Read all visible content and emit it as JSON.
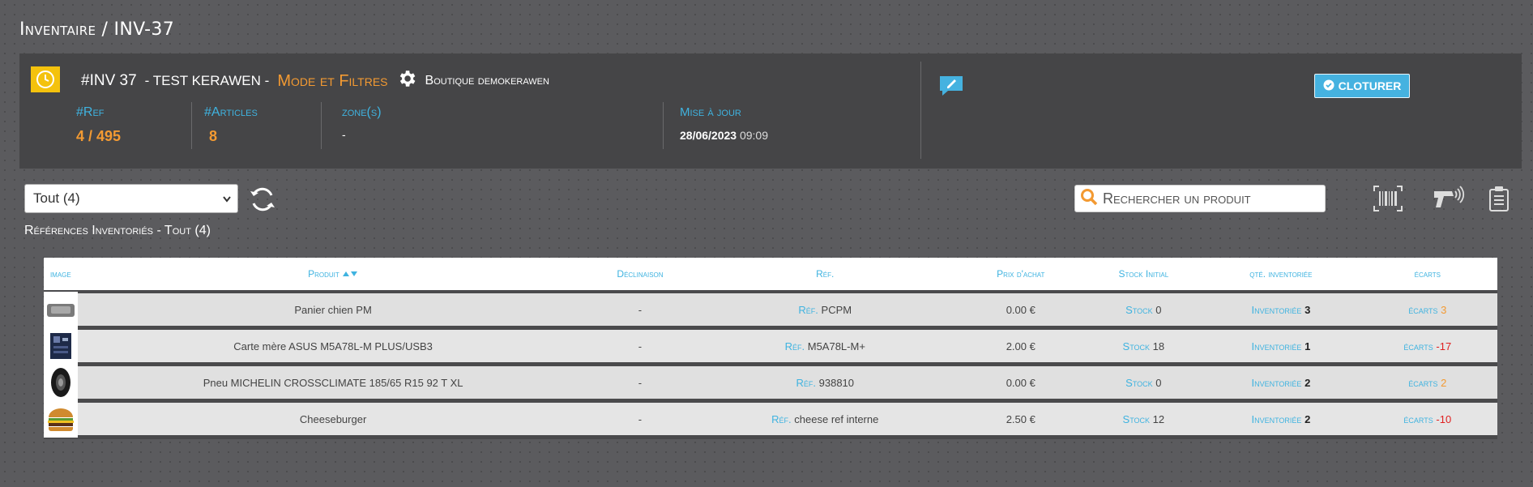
{
  "page": {
    "title": "Inventaire / INV-37"
  },
  "header": {
    "inv_number": "#INV 37",
    "inv_name": "- TEST KERAWEN -",
    "mode_link": "Mode et Filtres",
    "shop": "Boutique demokerawen",
    "stats": {
      "ref_label": "#Ref",
      "ref_value": "4 / 495",
      "articles_label": "#Articles",
      "articles_value": "8",
      "zone_label": "zone(s)",
      "zone_value": "-",
      "update_label": "Mise à jour",
      "update_date": "28/06/2023",
      "update_time": "09:09"
    },
    "cloturer_label": "CLOTURER"
  },
  "toolbar": {
    "filter_selected": "Tout (4)",
    "search_placeholder": "Rechercher un produit"
  },
  "subtitle": "Références Inventoriés - Tout (4)",
  "table": {
    "headers": {
      "image": "image",
      "produit": "Produit",
      "declinaison": "Déclinaison",
      "ref": "Réf.",
      "prix": "Prix d'achat",
      "stock": "Stock Initial",
      "qte": "qté. inventoriée",
      "ecarts": "écarts"
    },
    "prefix_ref": "Réf.",
    "prefix_stock": "Stock",
    "prefix_inv": "Inventoriée",
    "prefix_ecarts": "écarts",
    "rows": [
      {
        "product": "Panier chien PM",
        "decl": "-",
        "ref": "PCPM",
        "prix": "0.00 €",
        "stock": "0",
        "inv": "3",
        "ecart": "3"
      },
      {
        "product": "Carte mère ASUS M5A78L-M PLUS/USB3",
        "decl": "-",
        "ref": "M5A78L-M+",
        "prix": "2.00 €",
        "stock": "18",
        "inv": "1",
        "ecart": "-17"
      },
      {
        "product": "Pneu MICHELIN CROSSCLIMATE 185/65 R15 92 T XL",
        "decl": "-",
        "ref": "938810",
        "prix": "0.00 €",
        "stock": "0",
        "inv": "2",
        "ecart": "2"
      },
      {
        "product": "Cheeseburger",
        "decl": "-",
        "ref": "cheese ref interne",
        "prix": "2.50 €",
        "stock": "12",
        "inv": "2",
        "ecart": "-10"
      }
    ]
  },
  "colors": {
    "accent_blue": "#3fb3e0",
    "accent_orange": "#f39a32",
    "negative": "#e02020"
  }
}
